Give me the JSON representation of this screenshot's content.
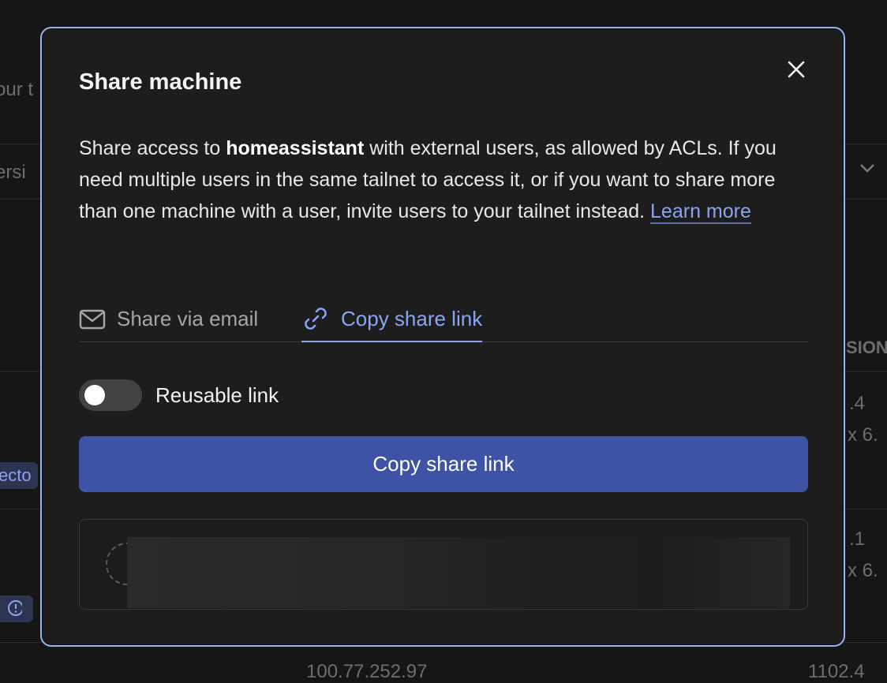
{
  "background": {
    "left_fragments": [
      "our t",
      "ersi",
      "ecto"
    ],
    "right_fragments": [
      "SION",
      ".4",
      "x 6.",
      ".1",
      "x 6."
    ],
    "bottom_fragments": [
      "100.77.252.97",
      "1102.4"
    ],
    "alert_icon": "exclamation-circle-icon"
  },
  "modal": {
    "title": "Share machine",
    "close_icon": "close-icon",
    "description": {
      "before": "Share access to ",
      "machine": "homeassistant",
      "after": " with external users, as allowed by ACLs. If you need multiple users in the same tailnet to access it, or if you want to share more than one machine with a user, invite users to your tailnet instead. ",
      "learn_more": "Learn more"
    },
    "tabs": [
      {
        "label": "Share via email",
        "icon": "mail-icon",
        "active": false
      },
      {
        "label": "Copy share link",
        "icon": "link-icon",
        "active": true
      }
    ],
    "toggle": {
      "label": "Reusable link",
      "on": false
    },
    "copy_button_label": "Copy share link",
    "colors": {
      "accent": "#8aa5f4",
      "button": "#3e53a6",
      "border": "#94b4f3"
    }
  }
}
